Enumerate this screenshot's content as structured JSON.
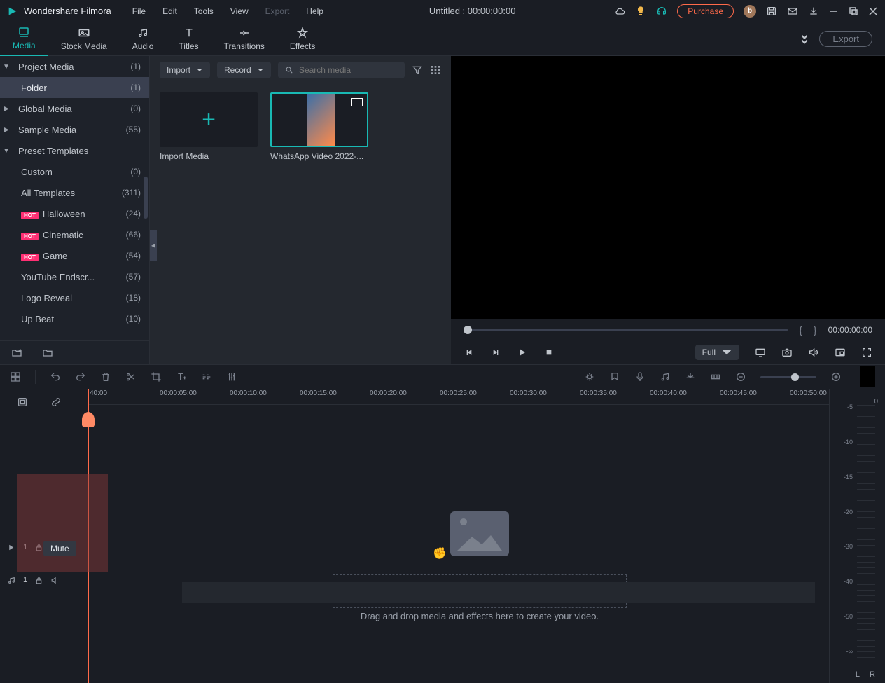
{
  "app_name": "Wondershare Filmora",
  "menu": [
    "File",
    "Edit",
    "Tools",
    "View",
    "Export",
    "Help"
  ],
  "menu_disabled": [
    4
  ],
  "project_title": "Untitled : 00:00:00:00",
  "purchase": "Purchase",
  "avatar": "b",
  "tabs": [
    {
      "label": "Media",
      "active": true
    },
    {
      "label": "Stock Media"
    },
    {
      "label": "Audio"
    },
    {
      "label": "Titles"
    },
    {
      "label": "Transitions"
    },
    {
      "label": "Effects"
    }
  ],
  "export_label": "Export",
  "sidebar": [
    {
      "label": "Project Media",
      "count": "(1)",
      "depth": 0,
      "arrow": "▼"
    },
    {
      "label": "Folder",
      "count": "(1)",
      "depth": 1,
      "sel": true
    },
    {
      "label": "Global Media",
      "count": "(0)",
      "depth": 0,
      "arrow": "▶"
    },
    {
      "label": "Sample Media",
      "count": "(55)",
      "depth": 0,
      "arrow": "▶"
    },
    {
      "label": "Preset Templates",
      "count": "",
      "depth": 0,
      "arrow": "▼"
    },
    {
      "label": "Custom",
      "count": "(0)",
      "depth": 1
    },
    {
      "label": "All Templates",
      "count": "(311)",
      "depth": 1
    },
    {
      "label": "Halloween",
      "count": "(24)",
      "depth": 1,
      "hot": true
    },
    {
      "label": "Cinematic",
      "count": "(66)",
      "depth": 1,
      "hot": true
    },
    {
      "label": "Game",
      "count": "(54)",
      "depth": 1,
      "hot": true
    },
    {
      "label": "YouTube Endscr...",
      "count": "(57)",
      "depth": 1
    },
    {
      "label": "Logo Reveal",
      "count": "(18)",
      "depth": 1
    },
    {
      "label": "Up Beat",
      "count": "(10)",
      "depth": 1
    }
  ],
  "hot_label": "HOT",
  "dropdowns": {
    "import": "Import",
    "record": "Record"
  },
  "search_placeholder": "Search media",
  "thumbs": [
    {
      "label": "Import Media",
      "kind": "add"
    },
    {
      "label": "WhatsApp Video 2022-...",
      "kind": "video",
      "sel": true
    }
  ],
  "preview": {
    "timecode": "00:00:00:00",
    "quality": "Full"
  },
  "ruler": [
    "40:00",
    "00:00:05:00",
    "00:00:10:00",
    "00:00:15:00",
    "00:00:20:00",
    "00:00:25:00",
    "00:00:30:00",
    "00:00:35:00",
    "00:00:40:00",
    "00:00:45:00",
    "00:00:50:00"
  ],
  "drop_hint": "Drag and drop media and effects here to create your video.",
  "meter": [
    "-5",
    "-10",
    "-15",
    "-20",
    "-30",
    "-40",
    "-50",
    "-∞"
  ],
  "meter_zero": "0",
  "meter_lr": [
    "L",
    "R"
  ],
  "mute_tip": "Mute",
  "track": {
    "video": "1",
    "audio": "1"
  }
}
